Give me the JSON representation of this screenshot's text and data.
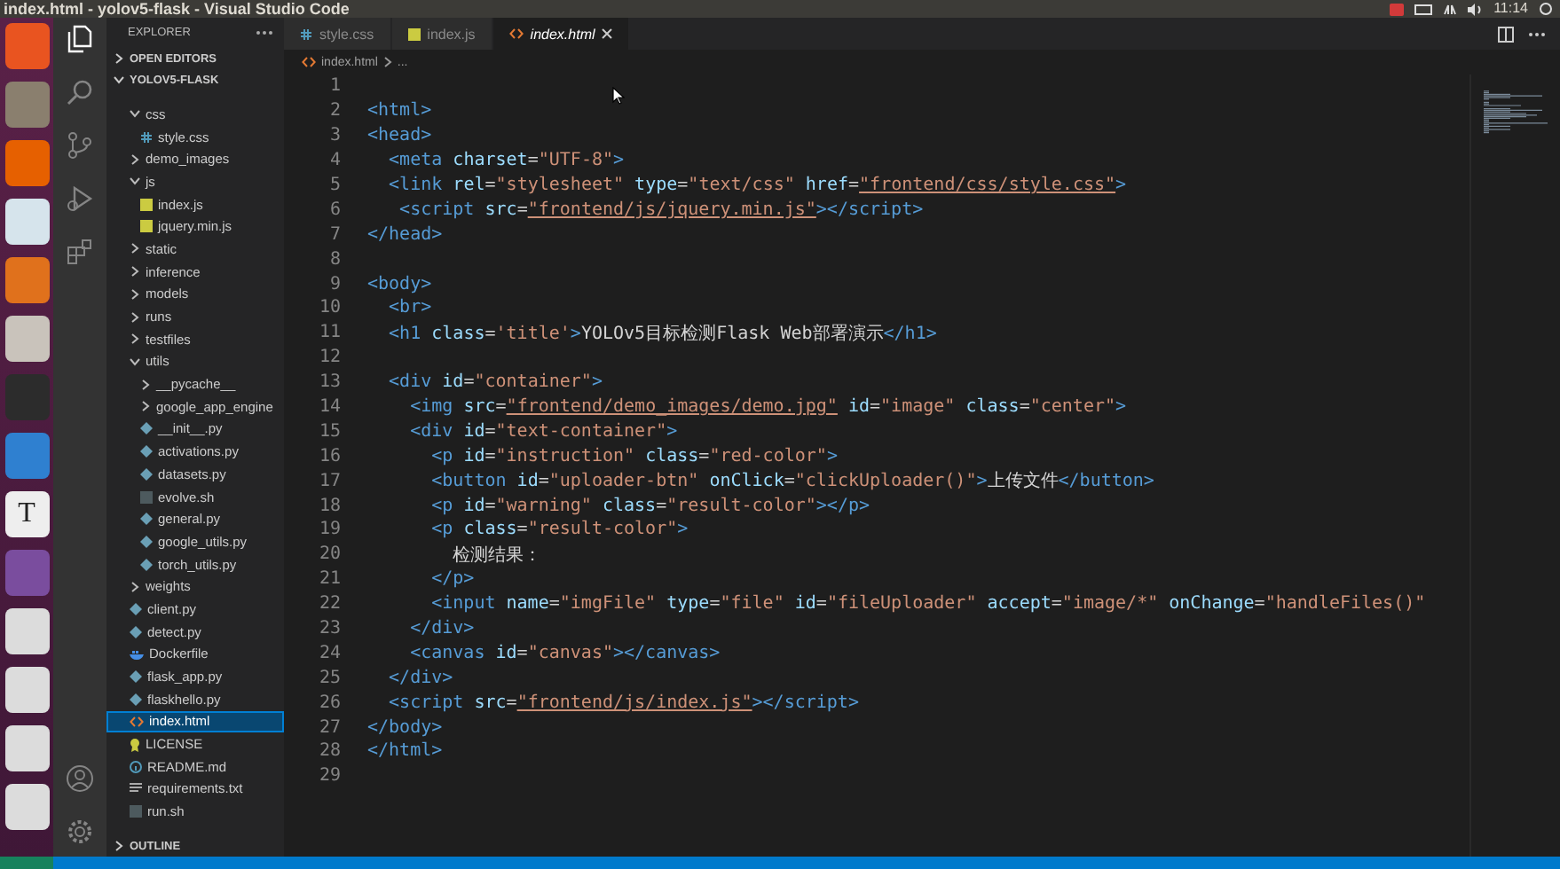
{
  "top_bar": {
    "title": "index.html - yolov5-flask - Visual Studio Code",
    "clock": "11:14"
  },
  "launcher": [
    {
      "kind": "ubuntu"
    },
    {
      "kind": "files"
    },
    {
      "kind": "firefox"
    },
    {
      "kind": "impress"
    },
    {
      "kind": "software"
    },
    {
      "kind": "tools"
    },
    {
      "kind": "terminal"
    },
    {
      "kind": "vscode"
    },
    {
      "kind": "text-editor",
      "label": "T"
    },
    {
      "kind": "screenshot"
    },
    {
      "kind": "disk"
    },
    {
      "kind": "disk"
    },
    {
      "kind": "disk"
    },
    {
      "kind": "disk"
    }
  ],
  "activity_bar": [
    {
      "kind": "explorer",
      "selected": true
    },
    {
      "kind": "search",
      "selected": false
    },
    {
      "kind": "source-control",
      "selected": false
    },
    {
      "kind": "run",
      "selected": false
    },
    {
      "kind": "extensions",
      "selected": false
    }
  ],
  "activity_bottom": [
    {
      "kind": "account"
    },
    {
      "kind": "settings"
    }
  ],
  "explorer": {
    "title": "EXPLORER",
    "sections": [
      {
        "label": "OPEN EDITORS",
        "expanded": false
      },
      {
        "label": "YOLOV5-FLASK",
        "expanded": true,
        "tree": [
          {
            "kind": "folder",
            "label": "css",
            "expanded": true,
            "selected": false,
            "children": [
              {
                "kind": "css",
                "label": "style.css",
                "selected": false
              }
            ]
          },
          {
            "kind": "folder",
            "label": "demo_images",
            "expanded": false,
            "selected": false
          },
          {
            "kind": "folder",
            "label": "js",
            "expanded": true,
            "selected": false,
            "children": [
              {
                "kind": "js",
                "label": "index.js",
                "selected": false
              },
              {
                "kind": "js",
                "label": "jquery.min.js",
                "selected": false
              }
            ]
          },
          {
            "kind": "folder",
            "label": "static",
            "expanded": false,
            "selected": false
          },
          {
            "kind": "folder",
            "label": "inference",
            "expanded": false,
            "selected": false
          },
          {
            "kind": "folder",
            "label": "models",
            "expanded": false,
            "selected": false
          },
          {
            "kind": "folder",
            "label": "runs",
            "expanded": false,
            "selected": false
          },
          {
            "kind": "folder",
            "label": "testfiles",
            "expanded": false,
            "selected": false
          },
          {
            "kind": "folder",
            "label": "utils",
            "expanded": true,
            "selected": false,
            "children": [
              {
                "kind": "folder",
                "label": "__pycache__",
                "expanded": false,
                "selected": false
              },
              {
                "kind": "folder",
                "label": "google_app_engine",
                "expanded": false,
                "selected": false
              },
              {
                "kind": "py",
                "label": "__init__.py",
                "selected": false
              },
              {
                "kind": "py",
                "label": "activations.py",
                "selected": false
              },
              {
                "kind": "py",
                "label": "datasets.py",
                "selected": false
              },
              {
                "kind": "sh",
                "label": "evolve.sh",
                "selected": false
              },
              {
                "kind": "py",
                "label": "general.py",
                "selected": false
              },
              {
                "kind": "py",
                "label": "google_utils.py",
                "selected": false
              },
              {
                "kind": "py",
                "label": "torch_utils.py",
                "selected": false
              }
            ]
          },
          {
            "kind": "folder",
            "label": "weights",
            "expanded": false,
            "selected": false
          },
          {
            "kind": "py",
            "label": "client.py",
            "selected": false
          },
          {
            "kind": "py",
            "label": "detect.py",
            "selected": false
          },
          {
            "kind": "docker",
            "label": "Dockerfile",
            "selected": false
          },
          {
            "kind": "py",
            "label": "flask_app.py",
            "selected": false
          },
          {
            "kind": "py",
            "label": "flaskhello.py",
            "selected": false
          },
          {
            "kind": "html",
            "label": "index.html",
            "selected": true
          },
          {
            "kind": "license",
            "label": "LICENSE",
            "selected": false
          },
          {
            "kind": "md",
            "label": "README.md",
            "selected": false
          },
          {
            "kind": "txt",
            "label": "requirements.txt",
            "selected": false
          },
          {
            "kind": "sh",
            "label": "run.sh",
            "selected": false
          }
        ]
      },
      {
        "label": "OUTLINE",
        "expanded": false
      }
    ]
  },
  "editor": {
    "tabs": [
      {
        "kind": "css",
        "label": "style.css",
        "selected": false
      },
      {
        "kind": "js",
        "label": "index.js",
        "selected": false
      },
      {
        "kind": "html",
        "label": "index.html",
        "selected": true
      }
    ],
    "breadcrumb": [
      "index.html",
      "..."
    ],
    "lines": [
      {
        "number": "1"
      },
      {
        "number": "2",
        "tokens": [
          {
            "kind": "tag",
            "text": "<html>"
          }
        ]
      },
      {
        "number": "3",
        "tokens": [
          {
            "kind": "tag",
            "text": "<head>"
          }
        ]
      },
      {
        "number": "4",
        "tokens": [
          {
            "kind": "tag",
            "text": "  <meta"
          },
          {
            "kind": "attr",
            "text": " charset"
          },
          {
            "kind": "text",
            "text": "="
          },
          {
            "kind": "str",
            "text": "\"UTF-8\""
          },
          {
            "kind": "tag",
            "text": ">"
          }
        ]
      },
      {
        "number": "5",
        "tokens": [
          {
            "kind": "tag",
            "text": "  <link"
          },
          {
            "kind": "attr",
            "text": " rel"
          },
          {
            "kind": "text",
            "text": "="
          },
          {
            "kind": "str",
            "text": "\"stylesheet\""
          },
          {
            "kind": "attr",
            "text": " type"
          },
          {
            "kind": "text",
            "text": "="
          },
          {
            "kind": "str",
            "text": "\"text/css\""
          },
          {
            "kind": "attr",
            "text": " href"
          },
          {
            "kind": "text",
            "text": "="
          },
          {
            "kind": "link",
            "text": "\"frontend/css/style.css\""
          },
          {
            "kind": "tag",
            "text": ">"
          }
        ]
      },
      {
        "number": "6",
        "tokens": [
          {
            "kind": "tag",
            "text": "   <script"
          },
          {
            "kind": "attr",
            "text": " src"
          },
          {
            "kind": "text",
            "text": "="
          },
          {
            "kind": "link",
            "text": "\"frontend/js/jquery.min.js\""
          },
          {
            "kind": "tag",
            "text": "></script>"
          }
        ]
      },
      {
        "number": "7",
        "tokens": [
          {
            "kind": "tag",
            "text": "</head>"
          }
        ]
      },
      {
        "number": "8"
      },
      {
        "number": "9",
        "tokens": [
          {
            "kind": "tag",
            "text": "<body>"
          }
        ]
      },
      {
        "number": "10",
        "tokens": [
          {
            "kind": "tag",
            "text": "  <br>"
          }
        ]
      },
      {
        "number": "11",
        "tokens": [
          {
            "kind": "tag",
            "text": "  <h1"
          },
          {
            "kind": "attr",
            "text": " class"
          },
          {
            "kind": "text",
            "text": "="
          },
          {
            "kind": "str",
            "text": "'title'"
          },
          {
            "kind": "tag",
            "text": ">"
          },
          {
            "kind": "text",
            "text": "YOLOv5目标检测Flask Web部署演示"
          },
          {
            "kind": "tag",
            "text": "</h1>"
          }
        ]
      },
      {
        "number": "12"
      },
      {
        "number": "13",
        "tokens": [
          {
            "kind": "tag",
            "text": "  <div"
          },
          {
            "kind": "attr",
            "text": " id"
          },
          {
            "kind": "text",
            "text": "="
          },
          {
            "kind": "str",
            "text": "\"container\""
          },
          {
            "kind": "tag",
            "text": ">"
          }
        ]
      },
      {
        "number": "14",
        "tokens": [
          {
            "kind": "tag",
            "text": "    <img"
          },
          {
            "kind": "attr",
            "text": " src"
          },
          {
            "kind": "text",
            "text": "="
          },
          {
            "kind": "link",
            "text": "\"frontend/demo_images/demo.jpg\""
          },
          {
            "kind": "attr",
            "text": " id"
          },
          {
            "kind": "text",
            "text": "="
          },
          {
            "kind": "str",
            "text": "\"image\""
          },
          {
            "kind": "attr",
            "text": " class"
          },
          {
            "kind": "text",
            "text": "="
          },
          {
            "kind": "str",
            "text": "\"center\""
          },
          {
            "kind": "tag",
            "text": ">"
          }
        ]
      },
      {
        "number": "15",
        "tokens": [
          {
            "kind": "tag",
            "text": "    <div"
          },
          {
            "kind": "attr",
            "text": " id"
          },
          {
            "kind": "text",
            "text": "="
          },
          {
            "kind": "str",
            "text": "\"text-container\""
          },
          {
            "kind": "tag",
            "text": ">"
          }
        ]
      },
      {
        "number": "16",
        "tokens": [
          {
            "kind": "tag",
            "text": "      <p"
          },
          {
            "kind": "attr",
            "text": " id"
          },
          {
            "kind": "text",
            "text": "="
          },
          {
            "kind": "str",
            "text": "\"instruction\""
          },
          {
            "kind": "attr",
            "text": " class"
          },
          {
            "kind": "text",
            "text": "="
          },
          {
            "kind": "str",
            "text": "\"red-color\""
          },
          {
            "kind": "tag",
            "text": ">"
          }
        ]
      },
      {
        "number": "17",
        "tokens": [
          {
            "kind": "tag",
            "text": "      <button"
          },
          {
            "kind": "attr",
            "text": " id"
          },
          {
            "kind": "text",
            "text": "="
          },
          {
            "kind": "str",
            "text": "\"uploader-btn\""
          },
          {
            "kind": "attr",
            "text": " onClick"
          },
          {
            "kind": "text",
            "text": "="
          },
          {
            "kind": "str",
            "text": "\"clickUploader()\""
          },
          {
            "kind": "tag",
            "text": ">"
          },
          {
            "kind": "text",
            "text": "上传文件"
          },
          {
            "kind": "tag",
            "text": "</button>"
          }
        ]
      },
      {
        "number": "18",
        "tokens": [
          {
            "kind": "tag",
            "text": "      <p"
          },
          {
            "kind": "attr",
            "text": " id"
          },
          {
            "kind": "text",
            "text": "="
          },
          {
            "kind": "str",
            "text": "\"warning\""
          },
          {
            "kind": "attr",
            "text": " class"
          },
          {
            "kind": "text",
            "text": "="
          },
          {
            "kind": "str",
            "text": "\"result-color\""
          },
          {
            "kind": "tag",
            "text": "></p>"
          }
        ]
      },
      {
        "number": "19",
        "tokens": [
          {
            "kind": "tag",
            "text": "      <p"
          },
          {
            "kind": "attr",
            "text": " class"
          },
          {
            "kind": "text",
            "text": "="
          },
          {
            "kind": "str",
            "text": "\"result-color\""
          },
          {
            "kind": "tag",
            "text": ">"
          }
        ]
      },
      {
        "number": "20",
        "tokens": [
          {
            "kind": "text",
            "text": "        检测结果："
          }
        ]
      },
      {
        "number": "21",
        "tokens": [
          {
            "kind": "tag",
            "text": "      </p>"
          }
        ]
      },
      {
        "number": "22",
        "tokens": [
          {
            "kind": "tag",
            "text": "      <input"
          },
          {
            "kind": "attr",
            "text": " name"
          },
          {
            "kind": "text",
            "text": "="
          },
          {
            "kind": "str",
            "text": "\"imgFile\""
          },
          {
            "kind": "attr",
            "text": " type"
          },
          {
            "kind": "text",
            "text": "="
          },
          {
            "kind": "str",
            "text": "\"file\""
          },
          {
            "kind": "attr",
            "text": " id"
          },
          {
            "kind": "text",
            "text": "="
          },
          {
            "kind": "str",
            "text": "\"fileUploader\""
          },
          {
            "kind": "attr",
            "text": " accept"
          },
          {
            "kind": "text",
            "text": "="
          },
          {
            "kind": "str",
            "text": "\"image/*\""
          },
          {
            "kind": "attr",
            "text": " onChange"
          },
          {
            "kind": "text",
            "text": "="
          },
          {
            "kind": "str",
            "text": "\"handleFiles()\""
          }
        ]
      },
      {
        "number": "23",
        "tokens": [
          {
            "kind": "tag",
            "text": "    </div>"
          }
        ]
      },
      {
        "number": "24",
        "tokens": [
          {
            "kind": "tag",
            "text": "    <canvas"
          },
          {
            "kind": "attr",
            "text": " id"
          },
          {
            "kind": "text",
            "text": "="
          },
          {
            "kind": "str",
            "text": "\"canvas\""
          },
          {
            "kind": "tag",
            "text": "></canvas>"
          }
        ]
      },
      {
        "number": "25",
        "tokens": [
          {
            "kind": "tag",
            "text": "  </div>"
          }
        ]
      },
      {
        "number": "26",
        "tokens": [
          {
            "kind": "tag",
            "text": "  <script"
          },
          {
            "kind": "attr",
            "text": " src"
          },
          {
            "kind": "text",
            "text": "="
          },
          {
            "kind": "link",
            "text": "\"frontend/js/index.js\""
          },
          {
            "kind": "tag",
            "text": "></script>"
          }
        ]
      },
      {
        "number": "27",
        "tokens": [
          {
            "kind": "tag",
            "text": "</body>"
          }
        ]
      },
      {
        "number": "28",
        "tokens": [
          {
            "kind": "tag",
            "text": "</html>"
          }
        ]
      },
      {
        "number": "29"
      }
    ]
  }
}
